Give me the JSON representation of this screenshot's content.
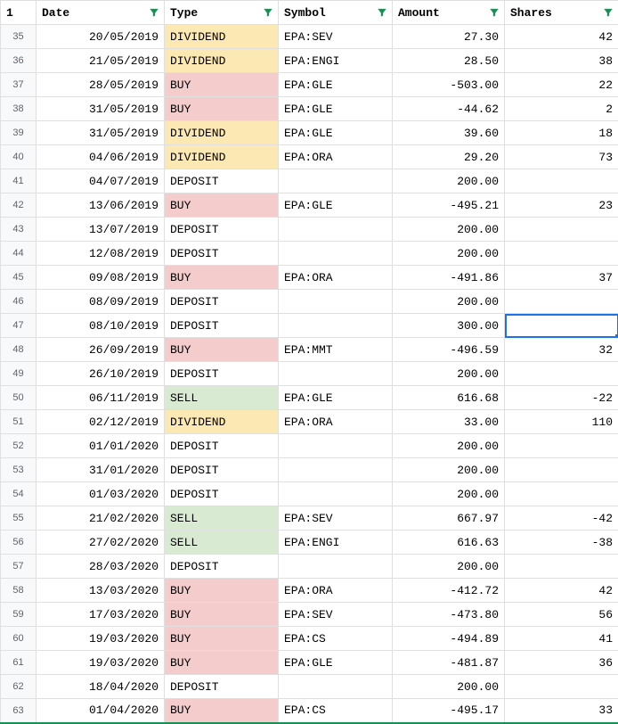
{
  "header": {
    "corner": "1"
  },
  "columns": [
    {
      "key": "date",
      "label": "Date"
    },
    {
      "key": "type",
      "label": "Type"
    },
    {
      "key": "symbol",
      "label": "Symbol"
    },
    {
      "key": "amount",
      "label": "Amount"
    },
    {
      "key": "shares",
      "label": "Shares"
    }
  ],
  "selected_cell": {
    "row": 47,
    "col": "shares"
  },
  "rows": [
    {
      "n": 35,
      "date": "20/05/2019",
      "type": "DIVIDEND",
      "symbol": "EPA:SEV",
      "amount": "27.30",
      "shares": "42"
    },
    {
      "n": 36,
      "date": "21/05/2019",
      "type": "DIVIDEND",
      "symbol": "EPA:ENGI",
      "amount": "28.50",
      "shares": "38"
    },
    {
      "n": 37,
      "date": "28/05/2019",
      "type": "BUY",
      "symbol": "EPA:GLE",
      "amount": "-503.00",
      "shares": "22"
    },
    {
      "n": 38,
      "date": "31/05/2019",
      "type": "BUY",
      "symbol": "EPA:GLE",
      "amount": "-44.62",
      "shares": "2"
    },
    {
      "n": 39,
      "date": "31/05/2019",
      "type": "DIVIDEND",
      "symbol": "EPA:GLE",
      "amount": "39.60",
      "shares": "18"
    },
    {
      "n": 40,
      "date": "04/06/2019",
      "type": "DIVIDEND",
      "symbol": "EPA:ORA",
      "amount": "29.20",
      "shares": "73"
    },
    {
      "n": 41,
      "date": "04/07/2019",
      "type": "DEPOSIT",
      "symbol": "",
      "amount": "200.00",
      "shares": ""
    },
    {
      "n": 42,
      "date": "13/06/2019",
      "type": "BUY",
      "symbol": "EPA:GLE",
      "amount": "-495.21",
      "shares": "23"
    },
    {
      "n": 43,
      "date": "13/07/2019",
      "type": "DEPOSIT",
      "symbol": "",
      "amount": "200.00",
      "shares": ""
    },
    {
      "n": 44,
      "date": "12/08/2019",
      "type": "DEPOSIT",
      "symbol": "",
      "amount": "200.00",
      "shares": ""
    },
    {
      "n": 45,
      "date": "09/08/2019",
      "type": "BUY",
      "symbol": "EPA:ORA",
      "amount": "-491.86",
      "shares": "37"
    },
    {
      "n": 46,
      "date": "08/09/2019",
      "type": "DEPOSIT",
      "symbol": "",
      "amount": "200.00",
      "shares": ""
    },
    {
      "n": 47,
      "date": "08/10/2019",
      "type": "DEPOSIT",
      "symbol": "",
      "amount": "300.00",
      "shares": ""
    },
    {
      "n": 48,
      "date": "26/09/2019",
      "type": "BUY",
      "symbol": "EPA:MMT",
      "amount": "-496.59",
      "shares": "32"
    },
    {
      "n": 49,
      "date": "26/10/2019",
      "type": "DEPOSIT",
      "symbol": "",
      "amount": "200.00",
      "shares": ""
    },
    {
      "n": 50,
      "date": "06/11/2019",
      "type": "SELL",
      "symbol": "EPA:GLE",
      "amount": "616.68",
      "shares": "-22"
    },
    {
      "n": 51,
      "date": "02/12/2019",
      "type": "DIVIDEND",
      "symbol": "EPA:ORA",
      "amount": "33.00",
      "shares": "110"
    },
    {
      "n": 52,
      "date": "01/01/2020",
      "type": "DEPOSIT",
      "symbol": "",
      "amount": "200.00",
      "shares": ""
    },
    {
      "n": 53,
      "date": "31/01/2020",
      "type": "DEPOSIT",
      "symbol": "",
      "amount": "200.00",
      "shares": ""
    },
    {
      "n": 54,
      "date": "01/03/2020",
      "type": "DEPOSIT",
      "symbol": "",
      "amount": "200.00",
      "shares": ""
    },
    {
      "n": 55,
      "date": "21/02/2020",
      "type": "SELL",
      "symbol": "EPA:SEV",
      "amount": "667.97",
      "shares": "-42"
    },
    {
      "n": 56,
      "date": "27/02/2020",
      "type": "SELL",
      "symbol": "EPA:ENGI",
      "amount": "616.63",
      "shares": "-38"
    },
    {
      "n": 57,
      "date": "28/03/2020",
      "type": "DEPOSIT",
      "symbol": "",
      "amount": "200.00",
      "shares": ""
    },
    {
      "n": 58,
      "date": "13/03/2020",
      "type": "BUY",
      "symbol": "EPA:ORA",
      "amount": "-412.72",
      "shares": "42"
    },
    {
      "n": 59,
      "date": "17/03/2020",
      "type": "BUY",
      "symbol": "EPA:SEV",
      "amount": "-473.80",
      "shares": "56"
    },
    {
      "n": 60,
      "date": "19/03/2020",
      "type": "BUY",
      "symbol": "EPA:CS",
      "amount": "-494.89",
      "shares": "41"
    },
    {
      "n": 61,
      "date": "19/03/2020",
      "type": "BUY",
      "symbol": "EPA:GLE",
      "amount": "-481.87",
      "shares": "36"
    },
    {
      "n": 62,
      "date": "18/04/2020",
      "type": "DEPOSIT",
      "symbol": "",
      "amount": "200.00",
      "shares": ""
    },
    {
      "n": 63,
      "date": "01/04/2020",
      "type": "BUY",
      "symbol": "EPA:CS",
      "amount": "-495.17",
      "shares": "33"
    }
  ]
}
